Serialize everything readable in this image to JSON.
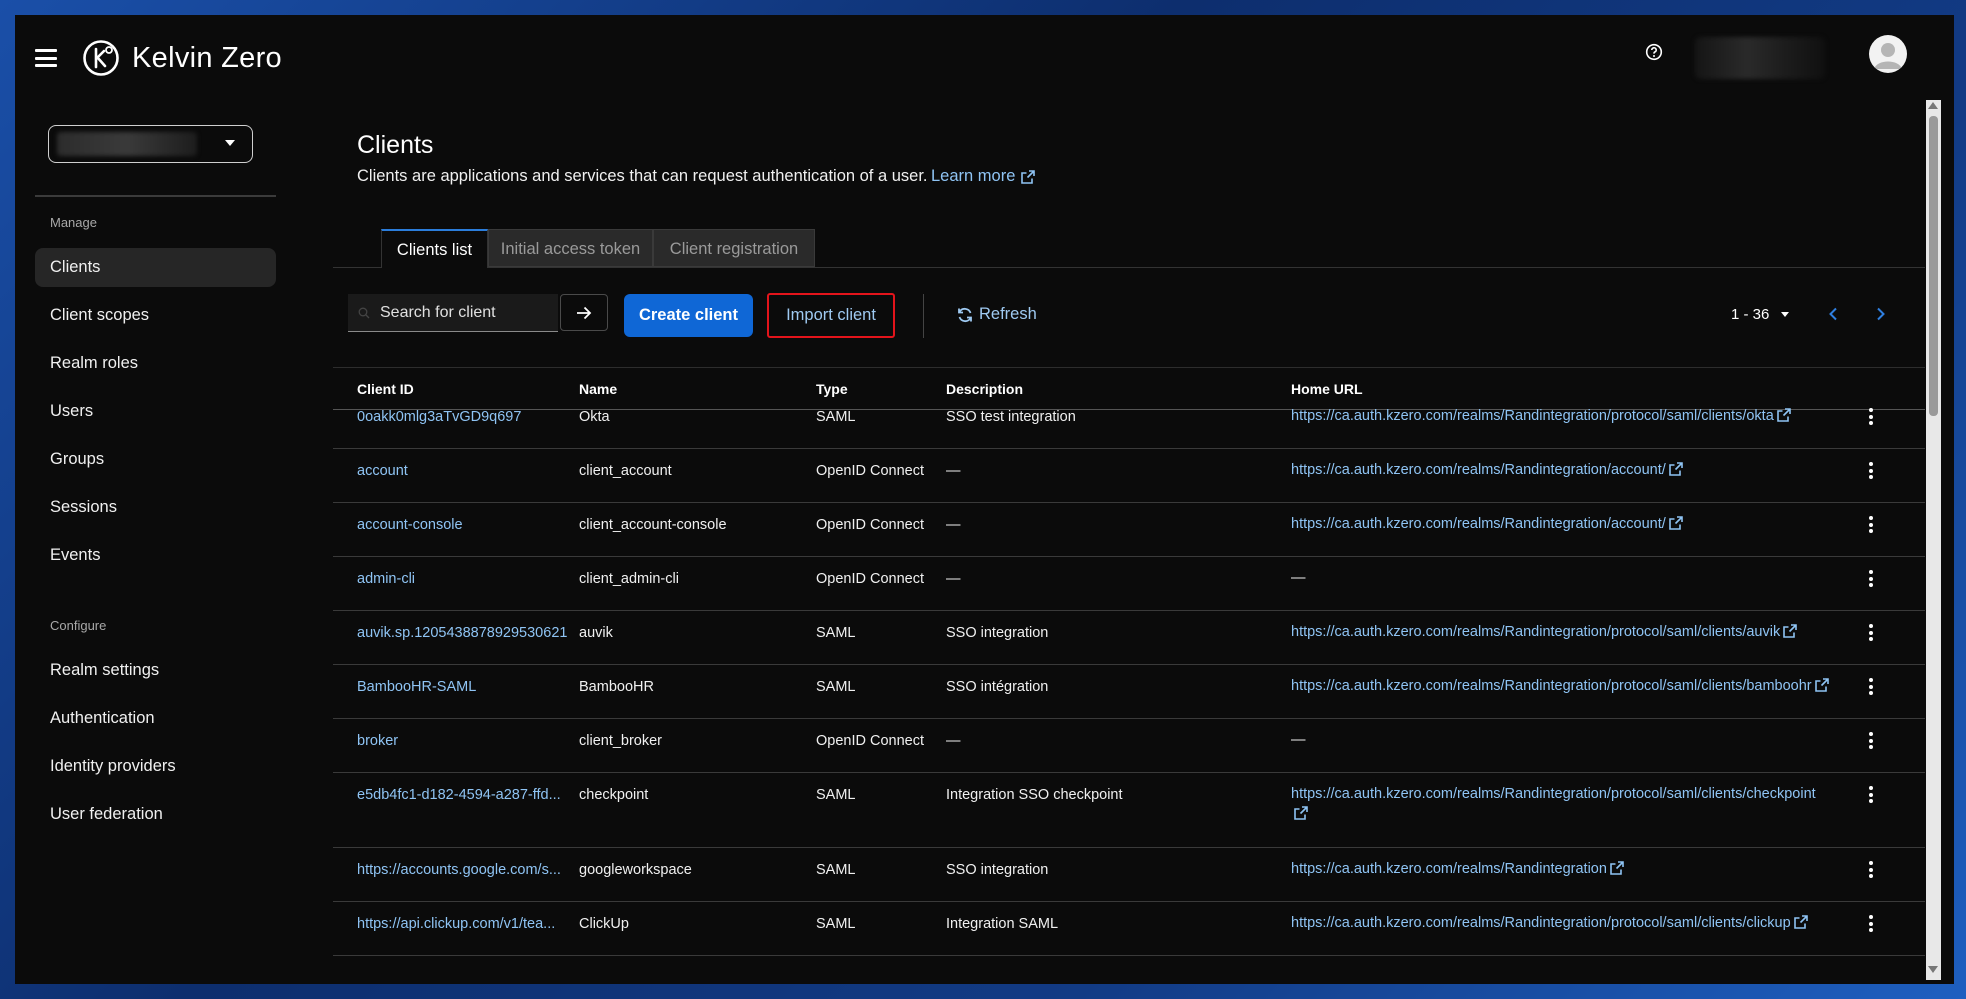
{
  "app": {
    "name": "Kelvin Zero"
  },
  "sidebar": {
    "sections": {
      "manage": "Manage",
      "configure": "Configure"
    },
    "manage_items": [
      {
        "label": "Clients",
        "name": "clients"
      },
      {
        "label": "Client scopes",
        "name": "client-scopes"
      },
      {
        "label": "Realm roles",
        "name": "realm-roles"
      },
      {
        "label": "Users",
        "name": "users"
      },
      {
        "label": "Groups",
        "name": "groups"
      },
      {
        "label": "Sessions",
        "name": "sessions"
      },
      {
        "label": "Events",
        "name": "events"
      }
    ],
    "configure_items": [
      {
        "label": "Realm settings",
        "name": "realm-settings"
      },
      {
        "label": "Authentication",
        "name": "authentication"
      },
      {
        "label": "Identity providers",
        "name": "identity-providers"
      },
      {
        "label": "User federation",
        "name": "user-federation"
      }
    ],
    "active": "Clients"
  },
  "page": {
    "title": "Clients",
    "description": "Clients are applications and services that can request authentication of a user.",
    "learn_more": "Learn more"
  },
  "tabs": [
    {
      "label": "Clients list",
      "active": true
    },
    {
      "label": "Initial access token",
      "active": false
    },
    {
      "label": "Client registration",
      "active": false
    }
  ],
  "toolbar": {
    "search_placeholder": "Search for client",
    "create_label": "Create client",
    "import_label": "Import client",
    "refresh_label": "Refresh",
    "pagination": "1 - 36"
  },
  "table": {
    "columns": [
      "Client ID",
      "Name",
      "Type",
      "Description",
      "Home URL"
    ],
    "rows": [
      {
        "id": "0oakk0mlg3aTvGD9q697",
        "name": "Okta",
        "type": "SAML",
        "description": "SSO test integration",
        "url": "https://ca.auth.kzero.com/realms/Randintegration/protocol/saml/clients/okta"
      },
      {
        "id": "account",
        "name": "client_account",
        "type": "OpenID Connect",
        "description": "—",
        "url": "https://ca.auth.kzero.com/realms/Randintegration/account/"
      },
      {
        "id": "account-console",
        "name": "client_account-console",
        "type": "OpenID Connect",
        "description": "—",
        "url": "https://ca.auth.kzero.com/realms/Randintegration/account/"
      },
      {
        "id": "admin-cli",
        "name": "client_admin-cli",
        "type": "OpenID Connect",
        "description": "—",
        "url": "—"
      },
      {
        "id": "auvik.sp.1205438878929530621",
        "name": "auvik",
        "type": "SAML",
        "description": "SSO integration",
        "url": "https://ca.auth.kzero.com/realms/Randintegration/protocol/saml/clients/auvik"
      },
      {
        "id": "BambooHR-SAML",
        "name": "BambooHR",
        "type": "SAML",
        "description": "SSO intégration",
        "url": "https://ca.auth.kzero.com/realms/Randintegration/protocol/saml/clients/bamboohr"
      },
      {
        "id": "broker",
        "name": "client_broker",
        "type": "OpenID Connect",
        "description": "—",
        "url": "—"
      },
      {
        "id": "e5db4fc1-d182-4594-a287-ffd...",
        "name": "checkpoint",
        "type": "SAML",
        "description": "Integration SSO checkpoint",
        "url": "https://ca.auth.kzero.com/realms/Randintegration/protocol/saml/clients/checkpoint"
      },
      {
        "id": "https://accounts.google.com/s...",
        "name": "googleworkspace",
        "type": "SAML",
        "description": "SSO integration",
        "url": "https://ca.auth.kzero.com/realms/Randintegration"
      },
      {
        "id": "https://api.clickup.com/v1/tea...",
        "name": "ClickUp",
        "type": "SAML",
        "description": "Integration SAML",
        "url": "https://ca.auth.kzero.com/realms/Randintegration/protocol/saml/clients/clickup"
      }
    ]
  },
  "colors": {
    "accent": "#0f67d6",
    "link": "#8fc4f4",
    "highlight": "#e3141b"
  }
}
